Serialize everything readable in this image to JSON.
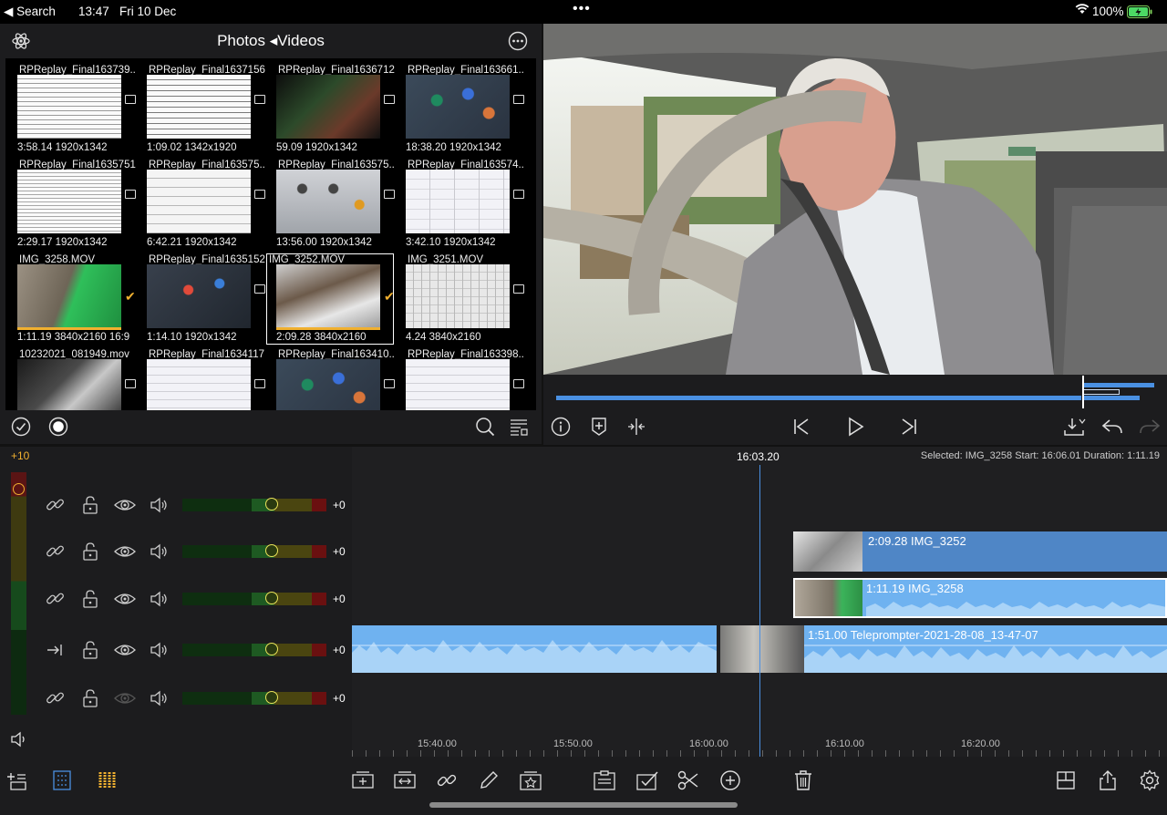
{
  "status": {
    "back": "◀ Search",
    "time": "13:47",
    "date": "Fri 10 Dec",
    "battery": "100%"
  },
  "browser": {
    "title": "Photos ◂Videos",
    "tiles": [
      {
        "name": "RPReplay_Final163739...",
        "meta": "3:58.14  1920x1342",
        "thumb": "doc-text"
      },
      {
        "name": "RPReplay_Final1637156...",
        "meta": "1:09.02  1342x1920",
        "thumb": "doc-text2"
      },
      {
        "name": "RPReplay_Final1636712...",
        "meta": "59.09  1920x1342",
        "thumb": "dark-web"
      },
      {
        "name": "RPReplay_Final163661...",
        "meta": "18:38.20  1920x1342",
        "thumb": "ios-home"
      },
      {
        "name": "RPReplay_Final1635751...",
        "meta": "2:29.17  1920x1342",
        "thumb": "doc-list"
      },
      {
        "name": "RPReplay_Final163575...",
        "meta": "6:42.21  1920x1342",
        "thumb": "doc-sparse"
      },
      {
        "name": "RPReplay_Final163575...",
        "meta": "13:56.00  1920x1342",
        "thumb": "calc"
      },
      {
        "name": "RPReplay_Final163574...",
        "meta": "3:42.10  1920x1342",
        "thumb": "settings"
      },
      {
        "name": "IMG_3258.MOV",
        "meta": "1:11.19  3840x2160  16:9",
        "thumb": "green-photo",
        "checked": true
      },
      {
        "name": "RPReplay_Final1635152...",
        "meta": "1:14.10  1920x1342",
        "thumb": "ios-control"
      },
      {
        "name": "IMG_3252.MOV",
        "meta": "2:09.28  3840x2160",
        "thumb": "desk",
        "checked": true,
        "selected": true
      },
      {
        "name": "IMG_3251.MOV",
        "meta": "4.24  3840x2160",
        "thumb": "keyboard"
      },
      {
        "name": "10232021_081949.mov",
        "meta": "",
        "thumb": "monitor"
      },
      {
        "name": "RPReplay_Final1634117...",
        "meta": "",
        "thumb": "settings2"
      },
      {
        "name": "RPReplay_Final163410...",
        "meta": "",
        "thumb": "ios-home"
      },
      {
        "name": "RPReplay_Final163398...",
        "meta": "",
        "thumb": "settings2"
      }
    ]
  },
  "timeline": {
    "playhead_time": "16:03.20",
    "selected_info": "Selected: IMG_3258 Start: 16:06.01 Duration: 1:11.19",
    "meter_level": "+10",
    "tracks": [
      {
        "mode": "link",
        "value": "+0",
        "fader": 0.62
      },
      {
        "mode": "link",
        "value": "+0",
        "fader": 0.62
      },
      {
        "mode": "link",
        "value": "+0",
        "fader": 0.62
      },
      {
        "mode": "arrow",
        "value": "+0",
        "fader": 0.62
      },
      {
        "mode": "link",
        "value": "+0",
        "fader": 0.62,
        "hidden": true
      }
    ],
    "ruler": [
      "15:40.00",
      "15:50.00",
      "16:00.00",
      "16:10.00",
      "16:20.00"
    ],
    "clips": {
      "c1": "2:09.28   IMG_3252",
      "c2": "1:11.19   IMG_3258",
      "c3": "1:51.00   Teleprompter-2021-28-08_13-47-07"
    }
  },
  "colors": {
    "accent": "#4a90e2",
    "clip_blue": "#4f86c6",
    "clip_light": "#6fb2f0",
    "check": "#f0b030"
  }
}
